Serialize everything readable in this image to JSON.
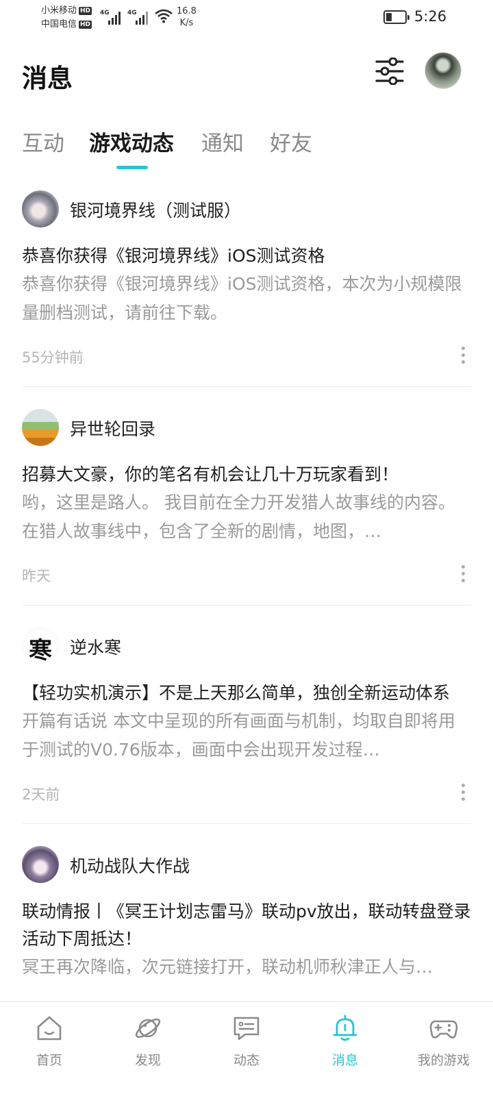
{
  "status_bar": {
    "carrier_1": "小米移动",
    "carrier_2": "中国电信",
    "hd_badge": "HD",
    "network_tag": "4G",
    "speed_value": "16.8",
    "speed_unit": "K/s",
    "time": "5:26",
    "battery_level": 0.3
  },
  "header": {
    "title": "消息",
    "filter_icon": "sliders-icon"
  },
  "tabs": [
    {
      "label": "互动",
      "active": false
    },
    {
      "label": "游戏动态",
      "active": true
    },
    {
      "label": "通知",
      "active": false
    },
    {
      "label": "好友",
      "active": false
    }
  ],
  "feed": [
    {
      "game": "银河境界线（测试服）",
      "title": "恭喜你获得《银河境界线》iOS测试资格",
      "body": "恭喜你获得《银河境界线》iOS测试资格，本次为小规模限量删档测试，请前往下载。",
      "time": "55分钟前"
    },
    {
      "game": "异世轮回录",
      "title": "招募大文豪，你的笔名有机会让几十万玩家看到！",
      "body": "哟，这里是路人。 我目前在全力开发猎人故事线的内容。 在猎人故事线中，包含了全新的剧情，地图，…",
      "time": "昨天"
    },
    {
      "game": "逆水寒",
      "avatar_glyph": "寒",
      "title": "【轻功实机演示】不是上天那么简单，独创全新运动体系",
      "body": "开篇有话说 本文中呈现的所有画面与机制，均取自即将用于测试的V0.76版本，画面中会出现开发过程…",
      "time": "2天前"
    },
    {
      "game": "机动战队大作战",
      "title": "联动情报丨《冥王计划志雷马》联动pv放出，联动转盘登录活动下周抵达！",
      "body": "冥王再次降临，次元链接打开，联动机师秋津正人与…",
      "time": ""
    }
  ],
  "bottom_nav": [
    {
      "label": "首页",
      "icon": "home-icon",
      "active": false
    },
    {
      "label": "发现",
      "icon": "planet-icon",
      "active": false
    },
    {
      "label": "动态",
      "icon": "chat-icon",
      "active": false
    },
    {
      "label": "消息",
      "icon": "bell-icon",
      "active": true
    },
    {
      "label": "我的游戏",
      "icon": "gamepad-icon",
      "active": false
    }
  ],
  "colors": {
    "accent": "#2bc3cf",
    "text_primary": "#1e1e1e",
    "text_secondary": "#9a9a9a",
    "text_tertiary": "#b5b5b5"
  }
}
